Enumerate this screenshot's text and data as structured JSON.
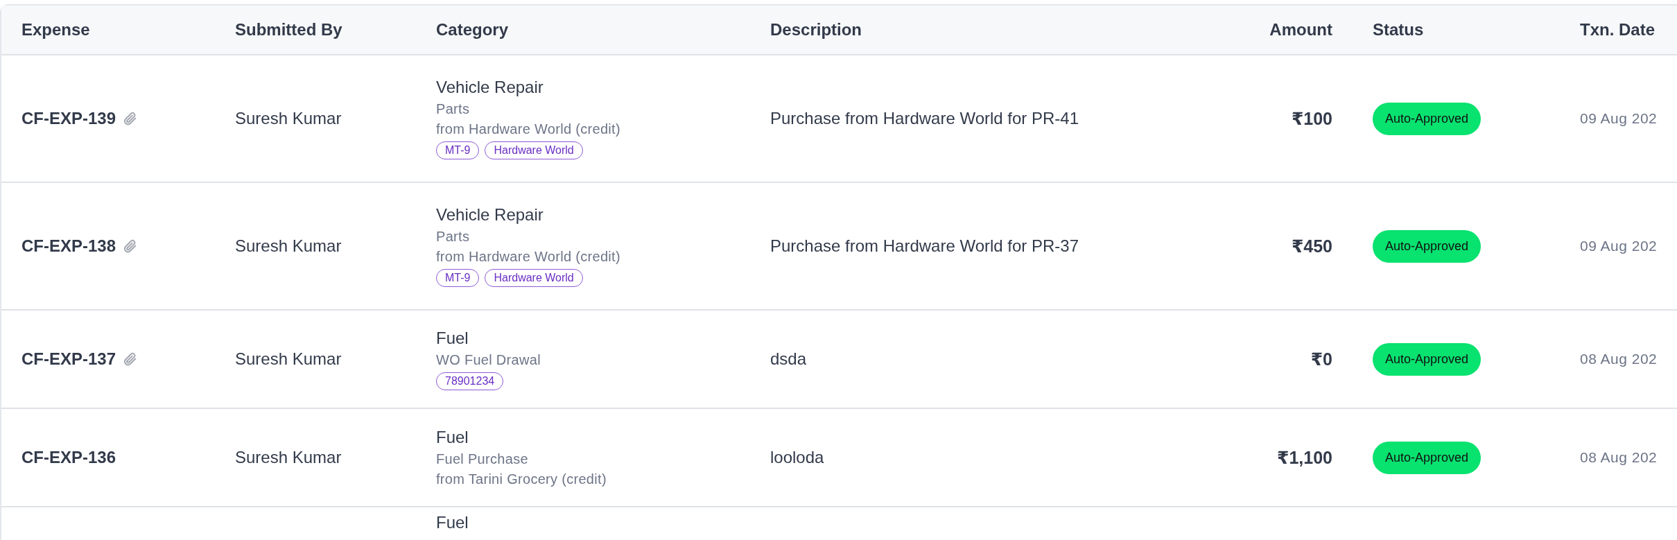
{
  "table": {
    "columns": [
      {
        "label": "Expense",
        "kind": "text"
      },
      {
        "label": "Submitted By",
        "kind": "text"
      },
      {
        "label": "Category",
        "kind": "text"
      },
      {
        "label": "Description",
        "kind": "text"
      },
      {
        "label": "Amount",
        "kind": "amount"
      },
      {
        "label": "Status",
        "kind": "text"
      },
      {
        "label": "Txn. Date",
        "kind": "text"
      }
    ],
    "rows": [
      {
        "expense": "CF-EXP-139",
        "attachment": true,
        "submitted_by": "Suresh Kumar",
        "category": "Vehicle Repair",
        "category_lines": [
          "Parts",
          "from Hardware World (credit)"
        ],
        "tags": [
          "MT-9",
          "Hardware World"
        ],
        "description": "Purchase from Hardware World for PR-41",
        "amount": "₹100",
        "status": {
          "label": "Auto-Approved",
          "kind": "approved"
        },
        "date": "09 Aug 202"
      },
      {
        "expense": "CF-EXP-138",
        "attachment": true,
        "submitted_by": "Suresh Kumar",
        "category": "Vehicle Repair",
        "category_lines": [
          "Parts",
          "from Hardware World (credit)"
        ],
        "tags": [
          "MT-9",
          "Hardware World"
        ],
        "description": "Purchase from Hardware World for PR-37",
        "amount": "₹450",
        "status": {
          "label": "Auto-Approved",
          "kind": "approved"
        },
        "date": "09 Aug 202"
      },
      {
        "expense": "CF-EXP-137",
        "attachment": true,
        "submitted_by": "Suresh Kumar",
        "category": "Fuel",
        "category_lines": [
          "WO Fuel Drawal"
        ],
        "tags": [
          "78901234"
        ],
        "description": "dsda",
        "amount": "₹0",
        "status": {
          "label": "Auto-Approved",
          "kind": "approved"
        },
        "date": "08 Aug 202"
      },
      {
        "expense": "CF-EXP-136",
        "attachment": false,
        "submitted_by": "Suresh Kumar",
        "category": "Fuel",
        "category_lines": [
          "Fuel Purchase",
          "from Tarini Grocery (credit)"
        ],
        "tags": [],
        "description": "looloda",
        "amount": "₹1,100",
        "status": {
          "label": "Auto-Approved",
          "kind": "approved"
        },
        "date": "08 Aug 202"
      },
      {
        "category": "Fuel"
      }
    ]
  }
}
